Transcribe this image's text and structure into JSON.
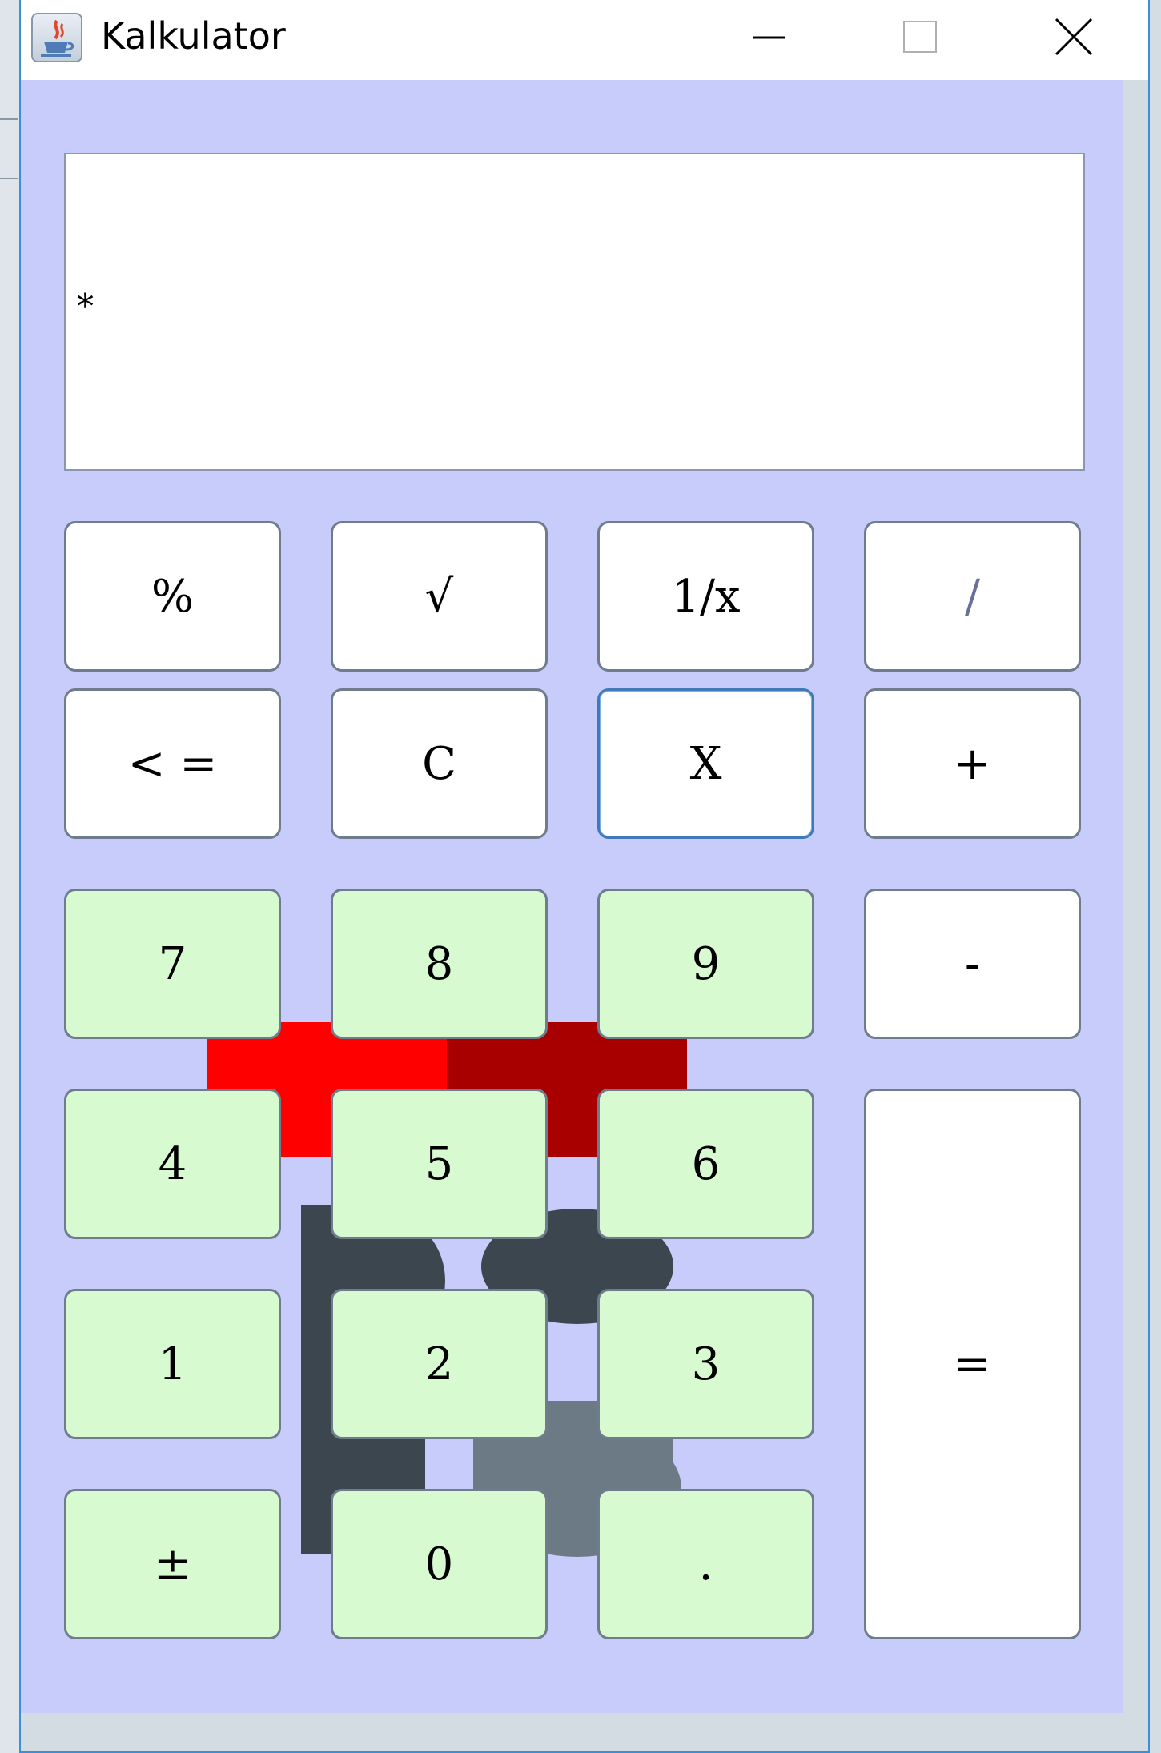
{
  "window": {
    "title": "Kalkulator",
    "app_icon": "java-cup-icon",
    "controls": [
      "minimize-icon",
      "maximize-icon",
      "close-icon"
    ]
  },
  "display": {
    "value": "*"
  },
  "buttons": {
    "percent": "%",
    "sqrt": "√",
    "reciprocal": "1/x",
    "divide": "/",
    "backspace": "< =",
    "clear": "C",
    "multiply": "X",
    "plus": "+",
    "seven": "7",
    "eight": "8",
    "nine": "9",
    "minus": "-",
    "four": "4",
    "five": "5",
    "six": "6",
    "equals": "=",
    "one": "1",
    "two": "2",
    "three": "3",
    "negate": "±",
    "zero": "0",
    "decimal": "."
  },
  "colors": {
    "panel_background": "#c7ccfb",
    "digit_button": "#d8fad1",
    "operator_button": "#ffffff",
    "logo_red": "#ff0000",
    "logo_dark_red": "#a80000",
    "logo_dark_gray": "#3c464e",
    "logo_gray": "#6c7a85"
  }
}
